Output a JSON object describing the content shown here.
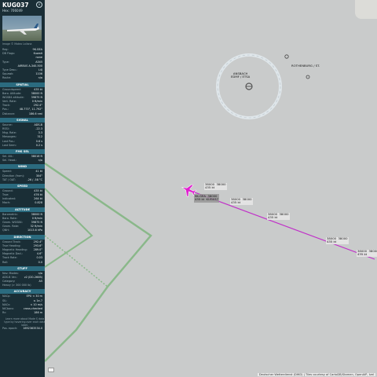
{
  "aircraft": {
    "callsign": "KUG037",
    "hex_label": "Hex: 706049",
    "photo_caption": "Image © Mateo Lallana"
  },
  "info_rows": [
    {
      "k": "Reg:",
      "v": "9K-GEA"
    },
    {
      "k": "DB Flags:",
      "v": "Kuwait"
    },
    {
      "k": "",
      "v": "none"
    },
    {
      "k": "Type:",
      "v": "A345"
    },
    {
      "k": "",
      "v": "AIRBUS A-340-500"
    },
    {
      "k": "Type Desc.:",
      "v": "L4J"
    },
    {
      "k": "Squawk:",
      "v": "1106"
    },
    {
      "k": "Route:",
      "v": "n/a"
    }
  ],
  "sections": {
    "spatial": "SPATIAL",
    "signal": "SIGNAL",
    "fms_sel": "FMS SEL",
    "wind": "WIND",
    "speed": "SPEED",
    "altitude": "ALTITUDE",
    "direction": "DIRECTION",
    "stuff": "STUFF",
    "accuracy": "ACCURACY"
  },
  "spatial_rows": [
    {
      "k": "Groundspeed:",
      "v": "435 kt"
    },
    {
      "k": "Baro. Altitude:",
      "v": "38000 ft"
    },
    {
      "k": "WGS84 altitude:",
      "v": "39875 ft"
    },
    {
      "k": "Vert. Rate:",
      "v": "0 ft/min"
    },
    {
      "k": "Track:",
      "v": "292.4°"
    },
    {
      "k": "Pos.:",
      "v": "48.773°, 11.792°"
    },
    {
      "k": "Distance:",
      "v": "186.6 nmi"
    }
  ],
  "signal_rows": [
    {
      "k": "Source:",
      "v": "ADS-B"
    },
    {
      "k": "RSSI:",
      "v": "-22.3"
    },
    {
      "k": "Msg. Rate:",
      "v": "3.3"
    },
    {
      "k": "Messages:",
      "v": "312"
    },
    {
      "k": "Last Pos.:",
      "v": "0.6 s"
    },
    {
      "k": "Last Seen:",
      "v": "0.2 s"
    }
  ],
  "fms_rows": [
    {
      "k": "Sel. Alt.:",
      "v": "38016 ft"
    },
    {
      "k": "Sel. Head.:",
      "v": "n/a"
    }
  ],
  "wind_rows": [
    {
      "k": "Speed:",
      "v": "41 kt"
    },
    {
      "k": "Direction (from):",
      "v": "304°"
    },
    {
      "k": "TAT / OAT:",
      "v": "-26 / -58 °C"
    }
  ],
  "speed_rows": [
    {
      "k": "Ground:",
      "v": "435 kt"
    },
    {
      "k": "True:",
      "v": "476 kt"
    },
    {
      "k": "Indicated:",
      "v": "264 kt"
    },
    {
      "k": "Mach:",
      "v": "0.828"
    }
  ],
  "altitude_rows": [
    {
      "k": "Barometric:",
      "v": "38000 ft"
    },
    {
      "k": "Baro. Rate:",
      "v": "0 ft/min"
    },
    {
      "k": "Geom. WGS84:",
      "v": "39875 ft"
    },
    {
      "k": "Geom. Rate:",
      "v": "32 ft/min"
    },
    {
      "k": "QNH:",
      "v": "1013.6 hPa"
    }
  ],
  "direction_rows": [
    {
      "k": "Ground Track:",
      "v": "292.4°"
    },
    {
      "k": "True Heading:",
      "v": "293.6°"
    },
    {
      "k": "Magnetic Heading:",
      "v": "289.0°"
    },
    {
      "k": "Magnetic Decl.:",
      "v": "4.6°"
    },
    {
      "k": "Track Rate:",
      "v": "0.03"
    },
    {
      "k": "Roll:",
      "v": "0.0"
    }
  ],
  "stuff_rows": [
    {
      "k": "Nav. Modes:",
      "v": "n/a"
    },
    {
      "k": "ADS-B Ver.:",
      "v": "v2 (DO-260B)"
    },
    {
      "k": "Category:",
      "v": "A5"
    },
    {
      "k": "Heavy (> 300 000 lb)",
      "v": ""
    }
  ],
  "accuracy_rows": [
    {
      "k": "NACp:",
      "v": "EPU < 30 m"
    },
    {
      "k": "SIL:",
      "v": "≤ 1e-7"
    },
    {
      "k": "NACv:",
      "v": "< 10 m/s"
    },
    {
      "k": "NICbaro:",
      "v": "cross-checked"
    },
    {
      "k": "Rc:",
      "v": "186 m"
    }
  ],
  "footer": {
    "note": "Learn more about Mode S data type by hovering over each data label.",
    "pos_epoch_label": "Pos. epoch:",
    "pos_epoch_value": "1692363534.0"
  },
  "map": {
    "attribution": "Deutscher Wetterdienst (DWD) | Tiles courtesy of CartoDB/Stamen, OpenAIP, Ivel",
    "airport_name": "ANSBACH",
    "airport_sub": "EDMF / ETSA",
    "airport2": "ROTHENBURG / ST.",
    "selected_label": "9K-GEA  38000\n435 kt  KUG037",
    "track_labels": [
      "38000  38000\n435 kt",
      "38000  38000\n435 kt",
      "38000  38000\n435 kt",
      "38000  38000\n435 kt",
      "38000  38000\n435 kt"
    ],
    "colors": {
      "track": "#c030c8",
      "aircraft": "#e020d0",
      "airspace": "#8ab88a"
    }
  }
}
